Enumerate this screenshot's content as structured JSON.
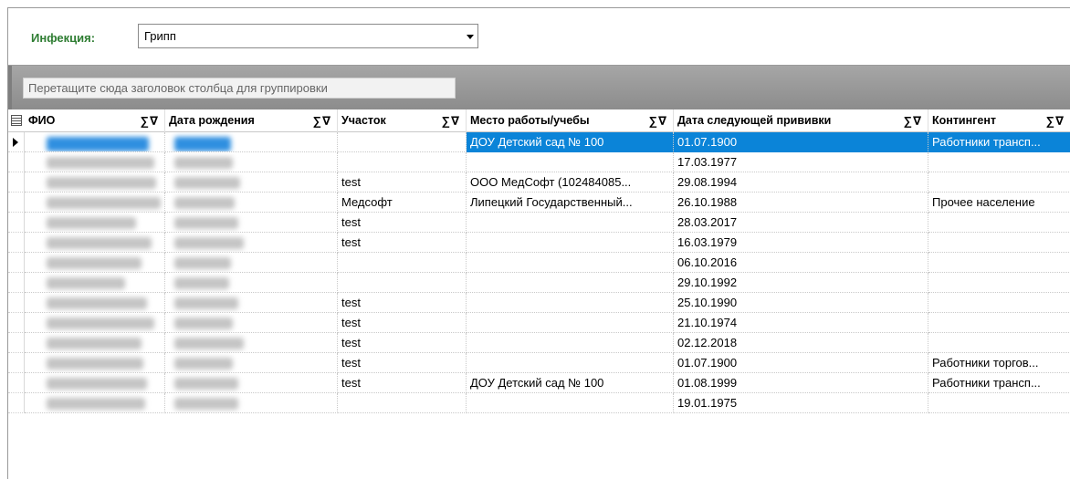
{
  "filter": {
    "label": "Инфекция:",
    "value": "Грипп"
  },
  "group_panel": {
    "hint": "Перетащите сюда заголовок столбца для группировки"
  },
  "columns": [
    {
      "key": "fio",
      "label": "ФИО",
      "icons": "∑∇"
    },
    {
      "key": "birth",
      "label": "Дата рождения",
      "icons": "∑∇"
    },
    {
      "key": "district",
      "label": "Участок",
      "icons": "∑∇"
    },
    {
      "key": "work",
      "label": "Место работы/учебы",
      "icons": "∑∇"
    },
    {
      "key": "next_date",
      "label": "Дата следующей прививки",
      "icons": "∑∇"
    },
    {
      "key": "contingent",
      "label": "Контингент",
      "icons": "∑∇"
    }
  ],
  "rows": [
    {
      "district": "",
      "work": "ДОУ Детский сад № 100",
      "next_date": "01.07.1900",
      "contingent": "Работники трансп..."
    },
    {
      "district": "",
      "work": "",
      "next_date": "17.03.1977",
      "contingent": ""
    },
    {
      "district": "test",
      "work": "ООО МедСофт (102484085...",
      "next_date": "29.08.1994",
      "contingent": ""
    },
    {
      "district": "Медсофт",
      "work": "Липецкий Государственный...",
      "next_date": "26.10.1988",
      "contingent": "Прочее население"
    },
    {
      "district": "test",
      "work": "",
      "next_date": "28.03.2017",
      "contingent": ""
    },
    {
      "district": "test",
      "work": "",
      "next_date": "16.03.1979",
      "contingent": ""
    },
    {
      "district": "",
      "work": "",
      "next_date": "06.10.2016",
      "contingent": ""
    },
    {
      "district": "",
      "work": "",
      "next_date": "29.10.1992",
      "contingent": ""
    },
    {
      "district": "test",
      "work": "",
      "next_date": "25.10.1990",
      "contingent": ""
    },
    {
      "district": "test",
      "work": "",
      "next_date": "21.10.1974",
      "contingent": ""
    },
    {
      "district": "test",
      "work": "",
      "next_date": "02.12.2018",
      "contingent": ""
    },
    {
      "district": "test",
      "work": "",
      "next_date": "01.07.1900",
      "contingent": "Работники торгов..."
    },
    {
      "district": "test",
      "work": "ДОУ Детский сад № 100",
      "next_date": "01.08.1999",
      "contingent": "Работники трансп..."
    },
    {
      "district": "",
      "work": "",
      "next_date": "19.01.1975",
      "contingent": ""
    }
  ],
  "selected_row": 0,
  "colors": {
    "selection": "#0b84d8",
    "label_green": "#2e7d32",
    "group_panel": "#9a9a9a"
  }
}
